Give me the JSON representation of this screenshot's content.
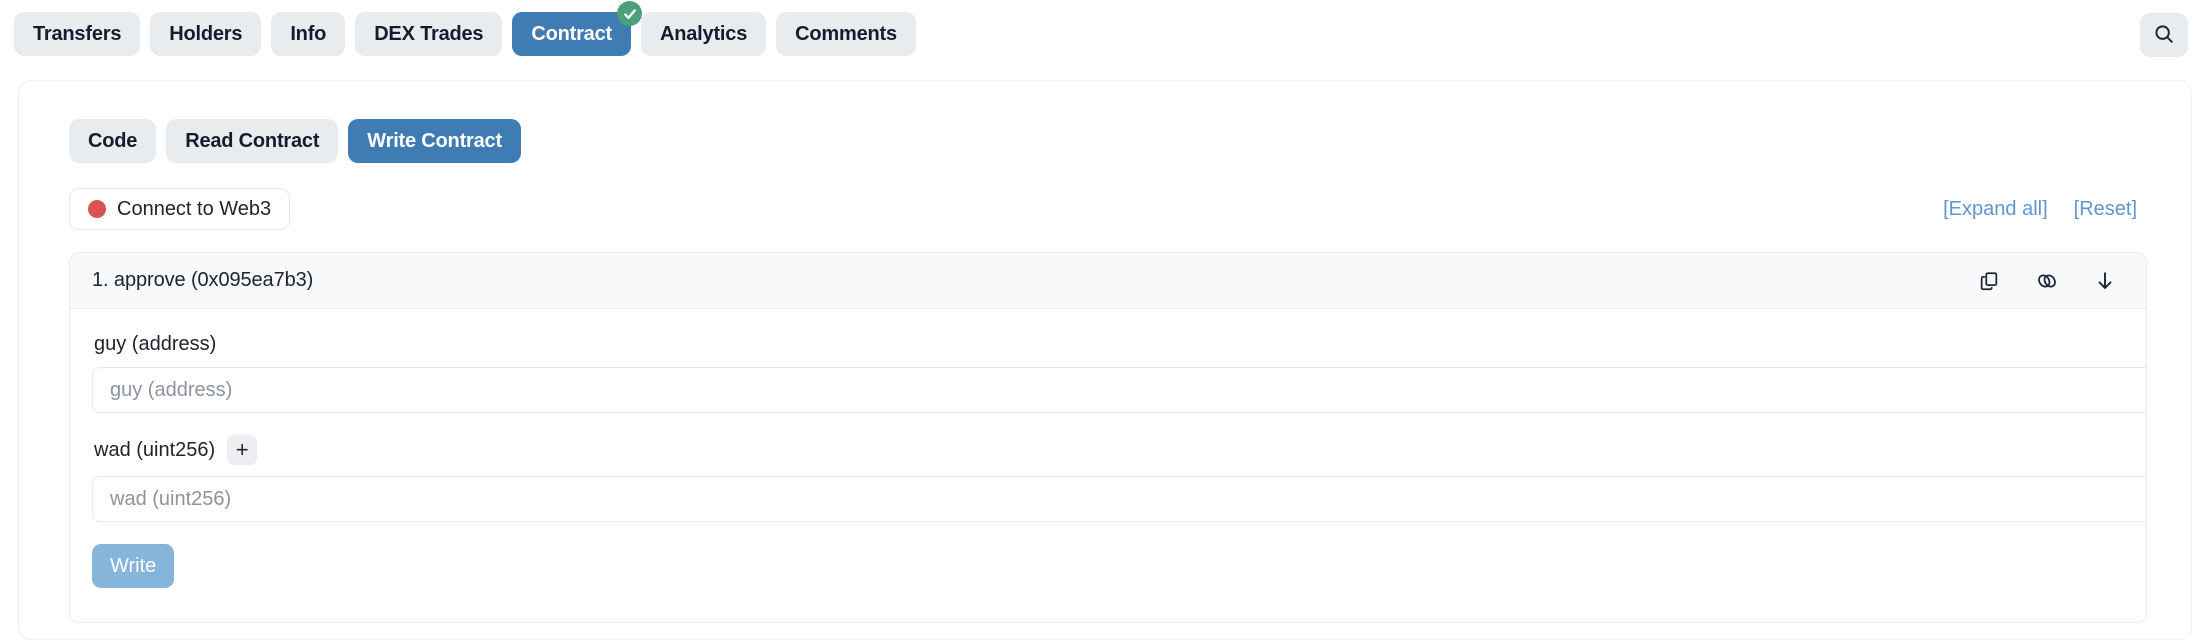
{
  "topbar": {
    "tabs": [
      {
        "label": "Transfers",
        "active": false,
        "badge": null
      },
      {
        "label": "Holders",
        "active": false,
        "badge": null
      },
      {
        "label": "Info",
        "active": false,
        "badge": null
      },
      {
        "label": "DEX Trades",
        "active": false,
        "badge": null
      },
      {
        "label": "Contract",
        "active": true,
        "badge": "verified-check"
      },
      {
        "label": "Analytics",
        "active": false,
        "badge": null
      },
      {
        "label": "Comments",
        "active": false,
        "badge": null
      }
    ],
    "search_icon": "search-icon"
  },
  "contract": {
    "subtabs": [
      {
        "label": "Code",
        "active": false
      },
      {
        "label": "Read Contract",
        "active": false
      },
      {
        "label": "Write Contract",
        "active": true
      }
    ],
    "connect": {
      "label": "Connect to Web3",
      "status_color": "#d9534f",
      "status_icon": "red-dot-icon"
    },
    "links": [
      {
        "label": "[Expand all]"
      },
      {
        "label": "[Reset]"
      }
    ],
    "function": {
      "title": "1. approve (0x095ea7b3)",
      "icons": [
        {
          "name": "copy-icon"
        },
        {
          "name": "link-icon"
        },
        {
          "name": "download-arrow-icon"
        }
      ],
      "fields": [
        {
          "label": "guy (address)",
          "placeholder": "guy (address)",
          "value": "",
          "has_plus": false
        },
        {
          "label": "wad (uint256)",
          "placeholder": "wad (uint256)",
          "value": "",
          "has_plus": true,
          "plus_label": "+"
        }
      ],
      "submit_label": "Write"
    }
  },
  "colors": {
    "accent": "#3f7cb4",
    "tab_bg": "#e9ecef",
    "link": "#5f96d1",
    "badge_green": "#4da07a",
    "status_red": "#d9534f",
    "write_button": "#87b4da"
  }
}
